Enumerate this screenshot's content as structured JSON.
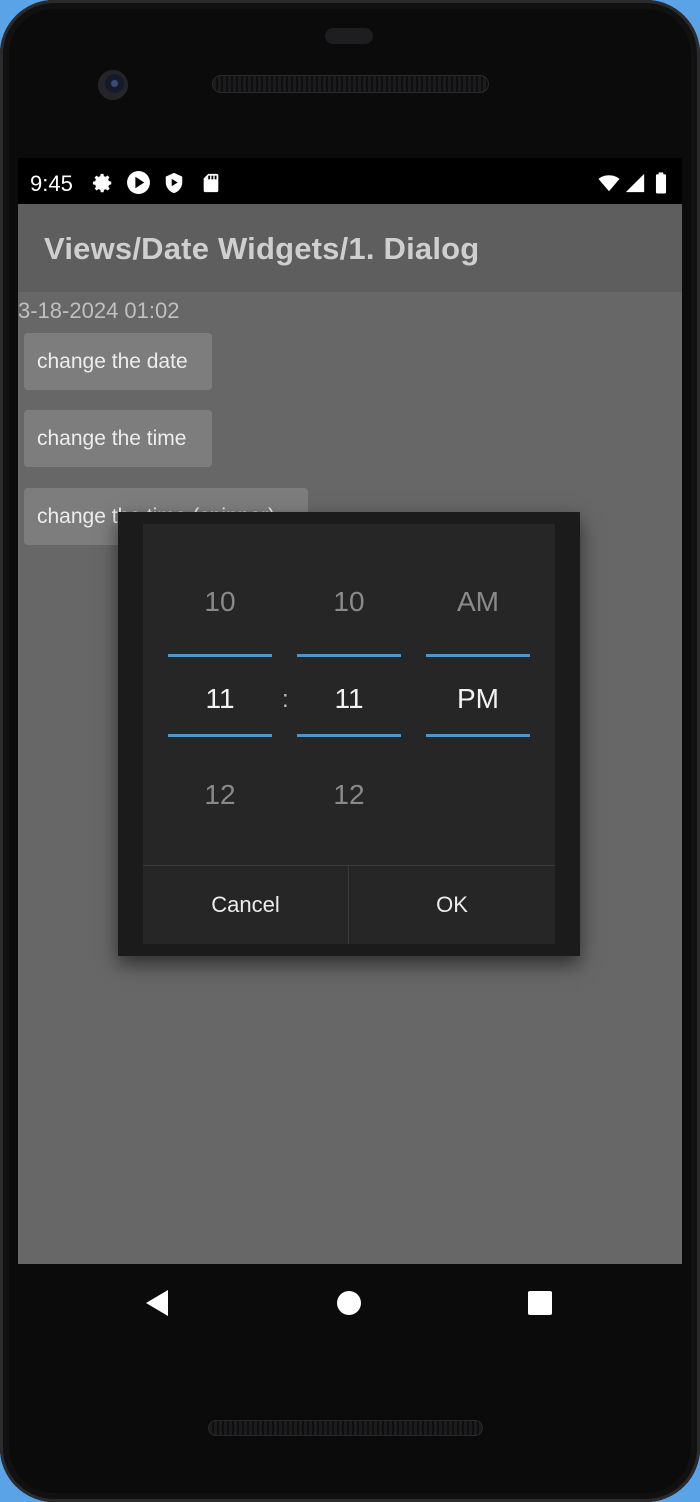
{
  "status_bar": {
    "time": "9:45",
    "left_icons": [
      "gear-icon",
      "play-circle-icon",
      "shield-play-icon",
      "sd-card-icon"
    ],
    "right_icons": [
      "wifi-icon",
      "signal-icon",
      "battery-icon"
    ]
  },
  "action_bar": {
    "title": "Views/Date Widgets/1. Dialog"
  },
  "content": {
    "datetime": "3-18-2024 01:02",
    "buttons": [
      {
        "label": "change the date"
      },
      {
        "label": "change the time"
      },
      {
        "label": "change the time (spinner)"
      }
    ]
  },
  "time_picker": {
    "hour": {
      "prev": "10",
      "current": "11",
      "next": "12"
    },
    "separator": ":",
    "minute": {
      "prev": "10",
      "current": "11",
      "next": "12"
    },
    "ampm": {
      "prev": "AM",
      "current": "PM"
    },
    "cancel_label": "Cancel",
    "ok_label": "OK"
  },
  "nav_bar": {
    "icons": [
      "back-icon",
      "home-icon",
      "recents-icon"
    ]
  },
  "colors": {
    "accent_divider": "#4f96c6",
    "dialog_bg": "#262626",
    "action_bar_bg": "#202020"
  }
}
